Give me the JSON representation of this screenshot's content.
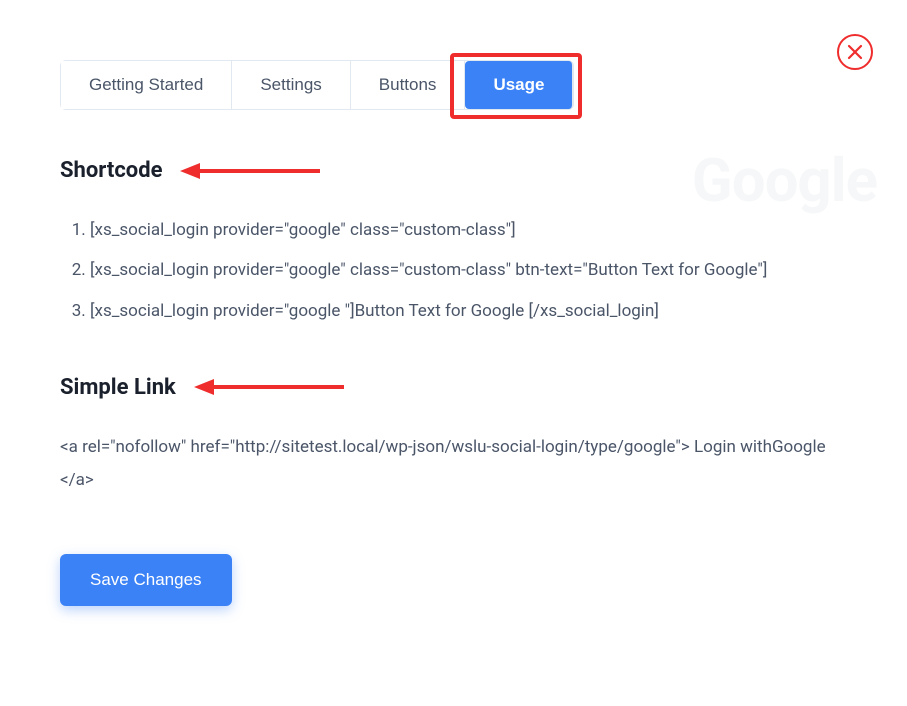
{
  "watermark": "Google",
  "tabs": [
    {
      "label": "Getting Started",
      "active": false
    },
    {
      "label": "Settings",
      "active": false
    },
    {
      "label": "Buttons",
      "active": false
    },
    {
      "label": "Usage",
      "active": true
    }
  ],
  "sections": {
    "shortcode": {
      "heading": "Shortcode",
      "items": [
        "[xs_social_login provider=\"google\" class=\"custom-class\"]",
        "[xs_social_login provider=\"google\" class=\"custom-class\" btn-text=\"Button Text for Google\"]",
        "[xs_social_login provider=\"google \"]Button Text for Google [/xs_social_login]"
      ]
    },
    "simplelink": {
      "heading": "Simple Link",
      "text": "<a rel=\"nofollow\" href=\"http://sitetest.local/wp-json/wslu-social-login/type/google\"> Login withGoogle </a>"
    }
  },
  "buttons": {
    "save": "Save Changes"
  }
}
